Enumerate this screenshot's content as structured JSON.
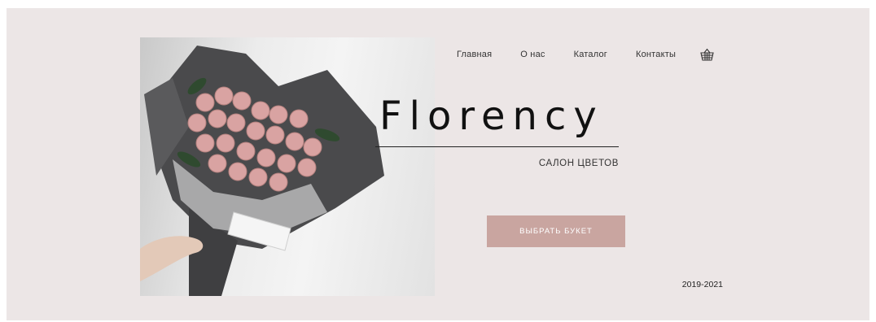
{
  "nav": {
    "items": [
      {
        "label": "Главная"
      },
      {
        "label": "О нас"
      },
      {
        "label": "Каталог"
      },
      {
        "label": "Контакты"
      }
    ],
    "cart_icon": "basket-icon"
  },
  "hero": {
    "brand": "Florency",
    "subtitle": "САЛОН ЦВЕТОВ",
    "cta_label": "ВЫБРАТЬ БУКЕТ",
    "years": "2019-2021",
    "image_icon": "flower-bouquet-image"
  },
  "colors": {
    "background": "#ece6e6",
    "accent": "#c9a5a0",
    "text": "#111111"
  }
}
